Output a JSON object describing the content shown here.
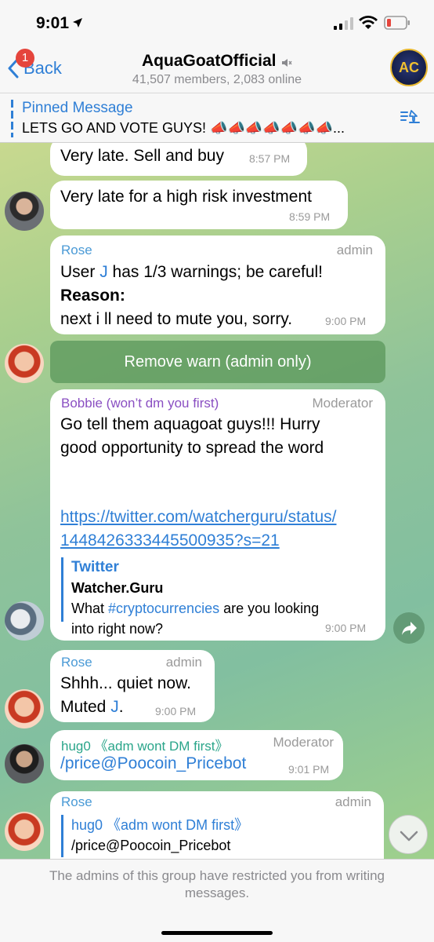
{
  "status_bar": {
    "time": "9:01"
  },
  "nav": {
    "back_label": "Back",
    "badge": "1",
    "title": "AquaGoatOfficial",
    "subtitle": "41,507 members, 2,083 online",
    "avatar_text": "AC"
  },
  "pinned": {
    "title": "Pinned Message",
    "text": "LETS GO AND VOTE GUYS! 📣📣📣📣📣📣📣..."
  },
  "messages": {
    "m1": {
      "text": "Very late. Sell and buy",
      "time": "8:57 PM"
    },
    "m2": {
      "text": "Very late for a high risk investment",
      "time": "8:59 PM"
    },
    "m3": {
      "sender": "Rose",
      "role": "admin",
      "line1_pre": "User ",
      "mention": "J",
      "line1_post": " has 1/3 warnings; be careful!",
      "reason_label": "Reason:",
      "line3": "next i ll need to mute you, sorry.",
      "time": "9:00 PM",
      "button": "Remove warn (admin only)"
    },
    "m4": {
      "sender": "Bobbie (won’t dm you first)",
      "role": "Moderator",
      "line1": "Go tell them aquagoat guys!!! Hurry",
      "line2": "good opportunity to spread the word",
      "link1": "https://twitter.com/watcherguru/status/",
      "link2": "1448426333445500935?s=21",
      "preview_site": "Twitter",
      "preview_title": "Watcher.Guru",
      "preview_pre": "What ",
      "preview_hashtag": "#cryptocurrencies",
      "preview_post": " are you looking",
      "preview_line2": "into right now?",
      "time": "9:00 PM"
    },
    "m5": {
      "sender": "Rose",
      "role": "admin",
      "line1": "Shhh... quiet now.",
      "line2_pre": "Muted ",
      "mention": "J",
      "line2_post": ".",
      "time": "9:00 PM"
    },
    "m6": {
      "sender": "hug0 《adm wont DM first》",
      "role": "Moderator",
      "text": "/price@Poocoin_Pricebot",
      "time": "9:01 PM"
    },
    "m7": {
      "sender": "Rose",
      "role": "admin",
      "reply_name": "hug0 《adm wont DM first》",
      "reply_text": "/price@Poocoin_Pricebot"
    }
  },
  "footer": {
    "text": "The admins of this group have restricted you from writing messages."
  },
  "colors": {
    "accent": "#2f7fd6",
    "badge": "#e5453c",
    "moderator_name": "#8a4fc2",
    "hug_name": "#2aa58a",
    "button_green": "#5c985c"
  }
}
